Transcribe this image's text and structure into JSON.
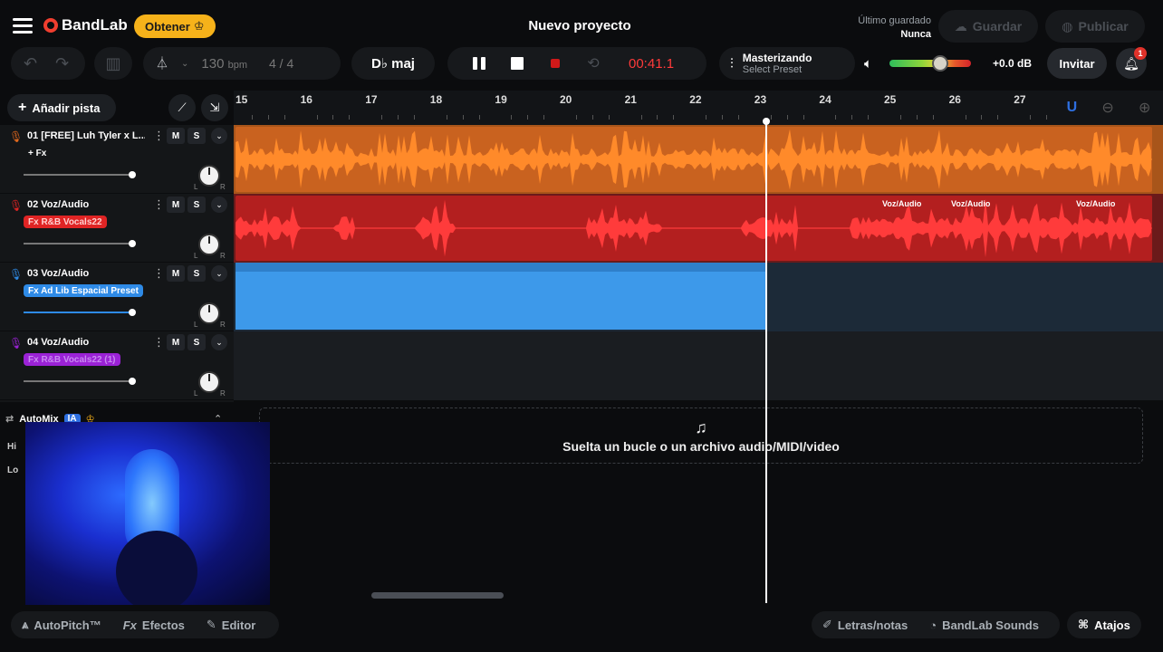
{
  "header": {
    "brand": "BandLab",
    "get_label": "Obtener",
    "project_title": "Nuevo proyecto",
    "last_saved_label": "Último guardado",
    "last_saved_value": "Nunca",
    "save_label": "Guardar",
    "publish_label": "Publicar"
  },
  "toolbar": {
    "bpm_value": "130",
    "bpm_unit": "bpm",
    "time_signature": "4 / 4",
    "key": "D♭ maj",
    "time": "00:41.1",
    "mastering_title": "Masterizando",
    "mastering_sub": "Select Preset",
    "gain": "+0.0 dB",
    "gain_level": 0.62,
    "invite_label": "Invitar",
    "notifications_count": "1"
  },
  "left": {
    "add_track_label": "Añadir pista",
    "tracks": [
      {
        "name": "01  [FREE] Luh Tyler x L...",
        "fx": "+ Fx",
        "color": "#e56a1e",
        "m": "M",
        "s": "S"
      },
      {
        "name": "02  Voz/Audio",
        "fx": "Fx R&B Vocals22",
        "color": "#e02424",
        "m": "M",
        "s": "S"
      },
      {
        "name": "03  Voz/Audio",
        "fx": "Fx Ad Lib Espacial Preset",
        "color": "#2e8ae6",
        "m": "M",
        "s": "S"
      },
      {
        "name": "04  Voz/Audio",
        "fx": "Fx R&B Vocals22 (1)",
        "color": "#9b22d6",
        "m": "M",
        "s": "S"
      }
    ],
    "automix_label": "AutoMix",
    "automix_badge": "IA",
    "side_labels": [
      "Hi",
      "Lo"
    ]
  },
  "ruler": {
    "bars": [
      "15",
      "16",
      "17",
      "18",
      "19",
      "20",
      "21",
      "22",
      "23",
      "24",
      "25",
      "26",
      "27"
    ]
  },
  "lanes": {
    "clip_labels": [
      "Voz/Audio",
      "Voz/Audio",
      "Voz/Audio"
    ]
  },
  "dropzone": {
    "text": "Suelta un bucle o un archivo audio/MIDI/video"
  },
  "bottom": {
    "autopitch": "AutoPitch™",
    "effects": "Efectos",
    "editor": "Editor",
    "lyrics": "Letras/notas",
    "sounds": "BandLab Sounds",
    "shortcuts": "Atajos"
  },
  "colors": {
    "accent": "#f03e2f",
    "obtener": "#f6b21a",
    "time": "#ff3a3a"
  }
}
